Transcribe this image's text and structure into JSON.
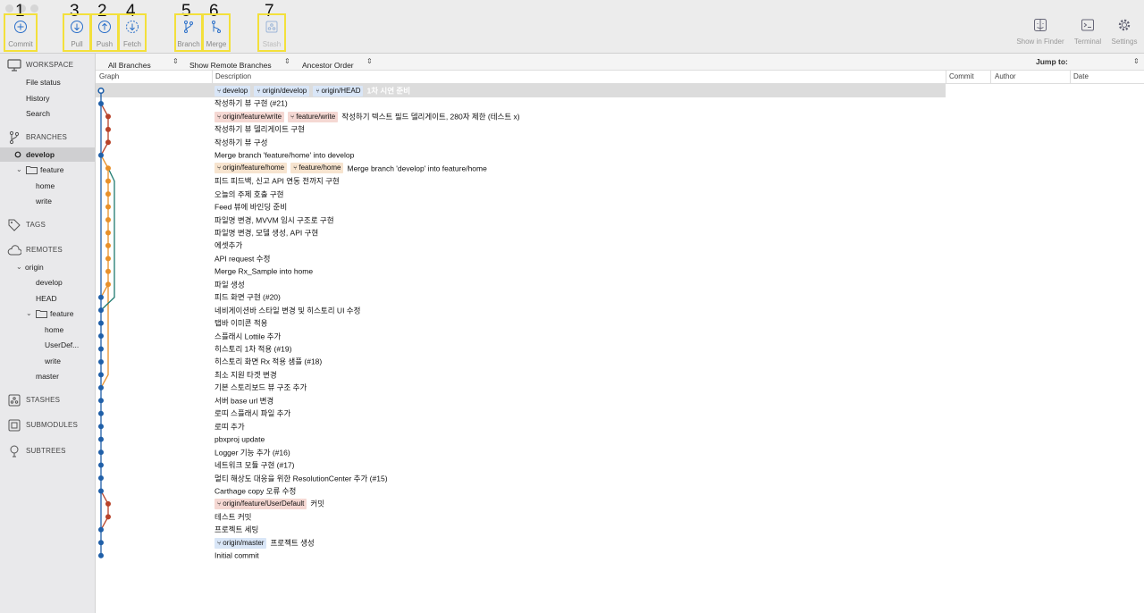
{
  "toolbar": {
    "buttons": [
      {
        "num": "1",
        "label": "Commit",
        "icon": "commit-plus-icon"
      },
      {
        "num": "3",
        "label": "Pull",
        "icon": "pull-arrow-down-icon"
      },
      {
        "num": "2",
        "label": "Push",
        "icon": "push-arrow-up-icon"
      },
      {
        "num": "4",
        "label": "Fetch",
        "icon": "fetch-dashed-arrow-icon"
      },
      {
        "num": "5",
        "label": "Branch",
        "icon": "branch-icon"
      },
      {
        "num": "6",
        "label": "Merge",
        "icon": "merge-icon"
      },
      {
        "num": "7",
        "label": "Stash",
        "icon": "stash-icon"
      }
    ],
    "right": [
      {
        "label": "Show in Finder",
        "icon": "finder-icon"
      },
      {
        "label": "Terminal",
        "icon": "terminal-icon"
      },
      {
        "label": "Settings",
        "icon": "gear-icon"
      }
    ]
  },
  "sidebar": {
    "workspace": "WORKSPACE",
    "file_status": "File status",
    "history": "History",
    "search": "Search",
    "branches": "BRANCHES",
    "develop": "develop",
    "feature": "feature",
    "home": "home",
    "write": "write",
    "tags": "TAGS",
    "remotes": "REMOTES",
    "origin": "origin",
    "r_develop": "develop",
    "r_head": "HEAD",
    "r_feature": "feature",
    "r_home": "home",
    "r_userdef": "UserDef...",
    "r_write": "write",
    "r_master": "master",
    "stashes": "STASHES",
    "submodules": "SUBMODULES",
    "subtrees": "SUBTREES"
  },
  "filter": {
    "branches": "All Branches",
    "remote": "Show Remote Branches",
    "order": "Ancestor Order",
    "jump": "Jump to:"
  },
  "columns": {
    "graph": "Graph",
    "description": "Description",
    "commit": "Commit",
    "author": "Author",
    "date": "Date"
  },
  "commits": [
    {
      "tags": [
        [
          "local",
          "develop"
        ],
        [
          "local",
          "origin/develop"
        ],
        [
          "local",
          "origin/HEAD"
        ]
      ],
      "msg": "1차 시연 준비",
      "selected": true
    },
    {
      "tags": [],
      "msg": "작성하기 뷰 구현 (#21)"
    },
    {
      "tags": [
        [
          "remote",
          "origin/feature/write"
        ],
        [
          "remote",
          "feature/write"
        ]
      ],
      "msg": "작성하기 텍스트 필드 델리게이트, 280자 제한 (테스트 x)"
    },
    {
      "tags": [],
      "msg": "작성하기 뷰 델리게이트 구현"
    },
    {
      "tags": [],
      "msg": "작성하기 뷰 구성"
    },
    {
      "tags": [],
      "msg": "Merge branch 'feature/home' into develop"
    },
    {
      "tags": [
        [
          "home",
          "origin/feature/home"
        ],
        [
          "home",
          "feature/home"
        ]
      ],
      "msg": "Merge branch 'develop' into feature/home"
    },
    {
      "tags": [],
      "msg": "피드 피드백, 신고 API 연동 전까지 구현"
    },
    {
      "tags": [],
      "msg": "오늘의 주제 호출 구현"
    },
    {
      "tags": [],
      "msg": "Feed 뷰에 바인딩 준비"
    },
    {
      "tags": [],
      "msg": "파일명 변경, MVVM 임시 구조로 구현"
    },
    {
      "tags": [],
      "msg": "파일명 변경, 모델 생성, API 구현"
    },
    {
      "tags": [],
      "msg": "에셋추가"
    },
    {
      "tags": [],
      "msg": "API request 수정"
    },
    {
      "tags": [],
      "msg": "Merge Rx_Sample into home"
    },
    {
      "tags": [],
      "msg": "파일 생성"
    },
    {
      "tags": [],
      "msg": "피드 화면 구현 (#20)"
    },
    {
      "tags": [],
      "msg": "네비게이션바 스타일 변경 및 히스토리 UI 수정"
    },
    {
      "tags": [],
      "msg": "탭바 이미콘 적용"
    },
    {
      "tags": [],
      "msg": " 스플래시 Lottile 추가"
    },
    {
      "tags": [],
      "msg": "히스토리 1차 적용 (#19)"
    },
    {
      "tags": [],
      "msg": "히스토리 화면 Rx 적용 샘플 (#18)"
    },
    {
      "tags": [],
      "msg": "최소 지원 타겟 변경"
    },
    {
      "tags": [],
      "msg": "기본 스토리보드 뷰 구조 추가"
    },
    {
      "tags": [],
      "msg": "서버 base url 변경"
    },
    {
      "tags": [],
      "msg": "로띠 스플래시 파일 추가"
    },
    {
      "tags": [],
      "msg": "로띠 추가"
    },
    {
      "tags": [],
      "msg": "pbxproj update"
    },
    {
      "tags": [],
      "msg": "Logger 기능 추가 (#16)"
    },
    {
      "tags": [],
      "msg": "네트워크 모듈 구현  (#17)"
    },
    {
      "tags": [],
      "msg": "멀티 해상도 대응을 위한 ResolutionCenter 추가 (#15)"
    },
    {
      "tags": [],
      "msg": "Carthage copy 오류 수정"
    },
    {
      "tags": [
        [
          "remote",
          "origin/feature/UserDefault"
        ]
      ],
      "msg": "커밋"
    },
    {
      "tags": [],
      "msg": "테스트 커밋"
    },
    {
      "tags": [],
      "msg": "프로젝트 세팅"
    },
    {
      "tags": [
        [
          "local",
          "origin/master"
        ]
      ],
      "msg": "프로젝트 생성"
    },
    {
      "tags": [],
      "msg": "Initial commit"
    }
  ],
  "colors": {
    "develop": "#1f5fa8",
    "write": "#b8432a",
    "home": "#e8902a",
    "teal": "#1f7a70",
    "highlight": "#f3e03b"
  }
}
